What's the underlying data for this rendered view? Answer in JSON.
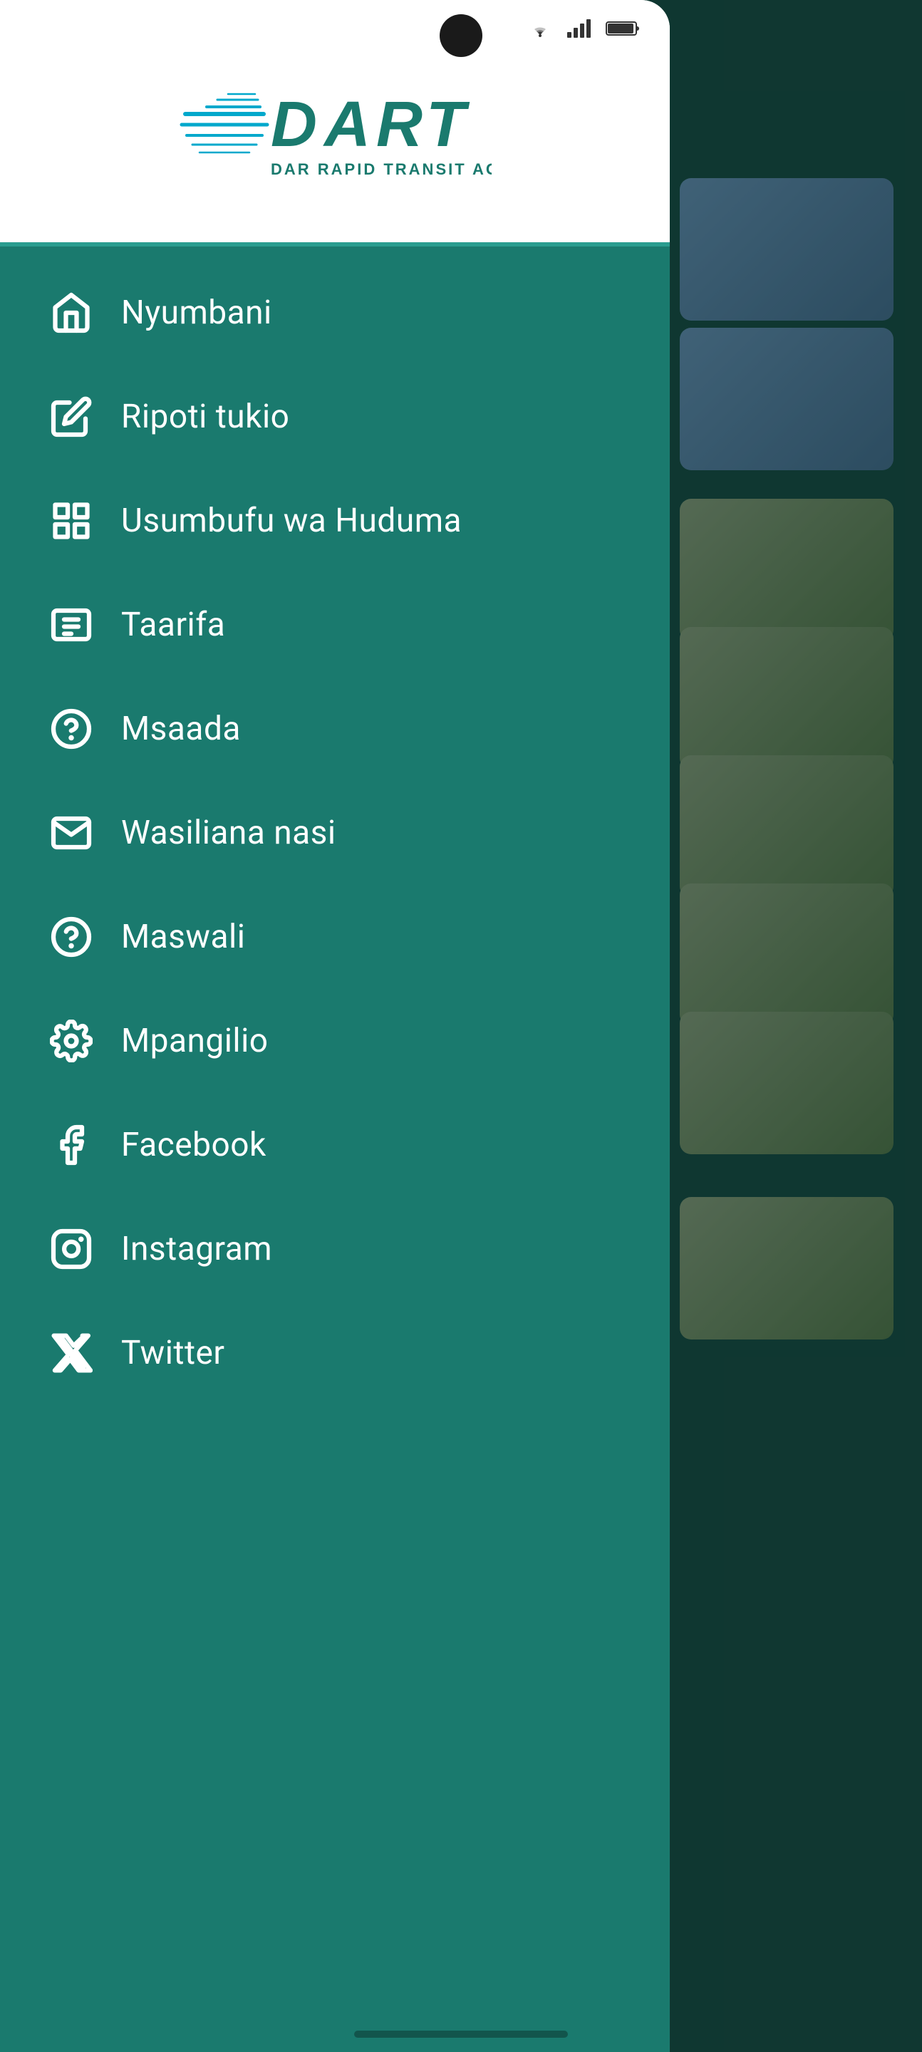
{
  "app": {
    "name": "DART",
    "full_name": "DAR RAPID TRANSIT AGENCY"
  },
  "drawer": {
    "menu_items": [
      {
        "id": "nyumbani",
        "label": "Nyumbani",
        "icon": "home"
      },
      {
        "id": "ripoti-tukio",
        "label": "Ripoti tukio",
        "icon": "edit"
      },
      {
        "id": "usumbufu-wa-huduma",
        "label": "Usumbufu wa Huduma",
        "icon": "grid"
      },
      {
        "id": "taarifa",
        "label": "Taarifa",
        "icon": "newspaper"
      },
      {
        "id": "msaada",
        "label": "Msaada",
        "icon": "help-circle"
      },
      {
        "id": "wasiliana-nasi",
        "label": "Wasiliana nasi",
        "icon": "mail"
      },
      {
        "id": "maswali",
        "label": "Maswali",
        "icon": "question"
      },
      {
        "id": "mpangilio",
        "label": "Mpangilio",
        "icon": "settings"
      },
      {
        "id": "facebook",
        "label": "Facebook",
        "icon": "facebook"
      },
      {
        "id": "instagram",
        "label": "Instagram",
        "icon": "instagram"
      },
      {
        "id": "twitter",
        "label": "Twitter",
        "icon": "twitter"
      }
    ]
  },
  "status_bar": {
    "wifi_icon": "wifi",
    "signal_icon": "signal",
    "battery_icon": "battery"
  }
}
